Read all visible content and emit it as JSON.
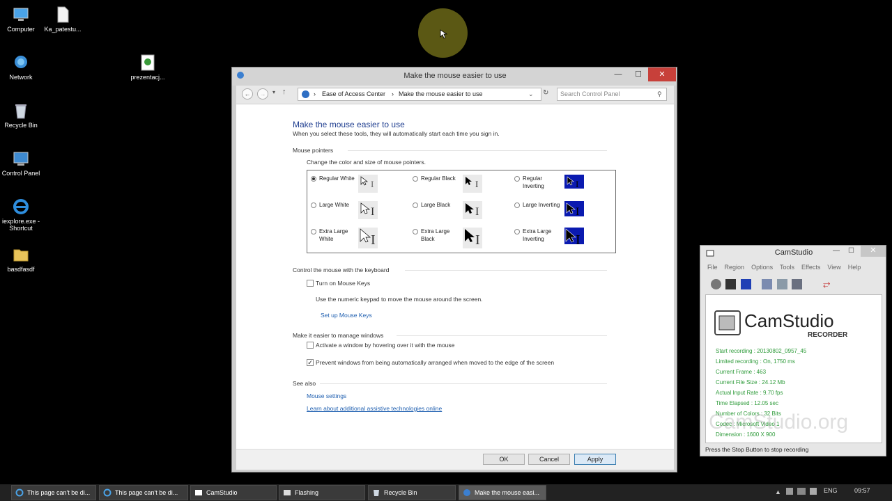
{
  "desktop": {
    "icons": [
      {
        "label": "Computer"
      },
      {
        "label": "Ka_patestu..."
      },
      {
        "label": "Network"
      },
      {
        "label": "prezentacj..."
      },
      {
        "label": "Recycle Bin"
      },
      {
        "label": "Control Panel"
      },
      {
        "label": "iexplore.exe - Shortcut"
      },
      {
        "label": "basdfasdf"
      }
    ]
  },
  "window": {
    "title": "Make the mouse easier to use",
    "minimize": "—",
    "maximize": "☐",
    "close": "✕",
    "breadcrumb": [
      "Ease of Access Center",
      "Make the mouse easier to use"
    ],
    "search_placeholder": "Search Control Panel",
    "heading": "Make the mouse easier to use",
    "subtitle": "When you select these tools, they will automatically start each time you sign in.",
    "pointers": {
      "section": "Mouse pointers",
      "instruction": "Change the color and size of mouse pointers.",
      "options": [
        {
          "label": "Regular White",
          "selected": true
        },
        {
          "label": "Regular Black",
          "selected": false
        },
        {
          "label": "Regular Inverting",
          "selected": false
        },
        {
          "label": "Large White",
          "selected": false
        },
        {
          "label": "Large Black",
          "selected": false
        },
        {
          "label": "Large Inverting",
          "selected": false
        },
        {
          "label": "Extra Large White",
          "selected": false
        },
        {
          "label": "Extra Large Black",
          "selected": false
        },
        {
          "label": "Extra Large Inverting",
          "selected": false
        }
      ]
    },
    "keyboard": {
      "section": "Control the mouse with the keyboard",
      "mouse_keys_label": "Turn on Mouse Keys",
      "mouse_keys_checked": false,
      "description": "Use the numeric keypad to move the mouse around the screen.",
      "setup_link": "Set up Mouse Keys"
    },
    "windows": {
      "section": "Make it easier to manage windows",
      "hover_label": "Activate a window by hovering over it with the mouse",
      "hover_checked": false,
      "prevent_label": "Prevent windows from being automatically arranged when moved to the edge of the screen",
      "prevent_checked": true
    },
    "see_also": {
      "section": "See also",
      "links": [
        "Mouse settings",
        "Learn about additional assistive technologies online"
      ]
    },
    "buttons": {
      "ok": "OK",
      "cancel": "Cancel",
      "apply": "Apply"
    }
  },
  "camstudio": {
    "title": "CamStudio",
    "menu": [
      "File",
      "Region",
      "Options",
      "Tools",
      "Effects",
      "View",
      "Help"
    ],
    "logo": "CamStudio",
    "logo_sub": "RECORDER",
    "stats": [
      "Start recording : 20130802_0957_45",
      "Limited recording : On, 1750 ms",
      "Current Frame : 463",
      "Current File Size : 24.12 Mb",
      "Actual Input Rate : 9.70 fps",
      "Time Elapsed : 12.05 sec",
      "Number of Colors : 32 Bits",
      "Codec : Microsoft Video 1",
      "Dimension : 1600 X 900"
    ],
    "watermark": "CamStudio.org",
    "status": "Press the Stop Button to stop recording"
  },
  "taskbar": {
    "items": [
      "This page can't be di...",
      "This page can't be di...",
      "CamStudio",
      "Flashing",
      "Recycle Bin",
      "Make the mouse easi..."
    ],
    "language": "ENG",
    "time": "09:57"
  }
}
